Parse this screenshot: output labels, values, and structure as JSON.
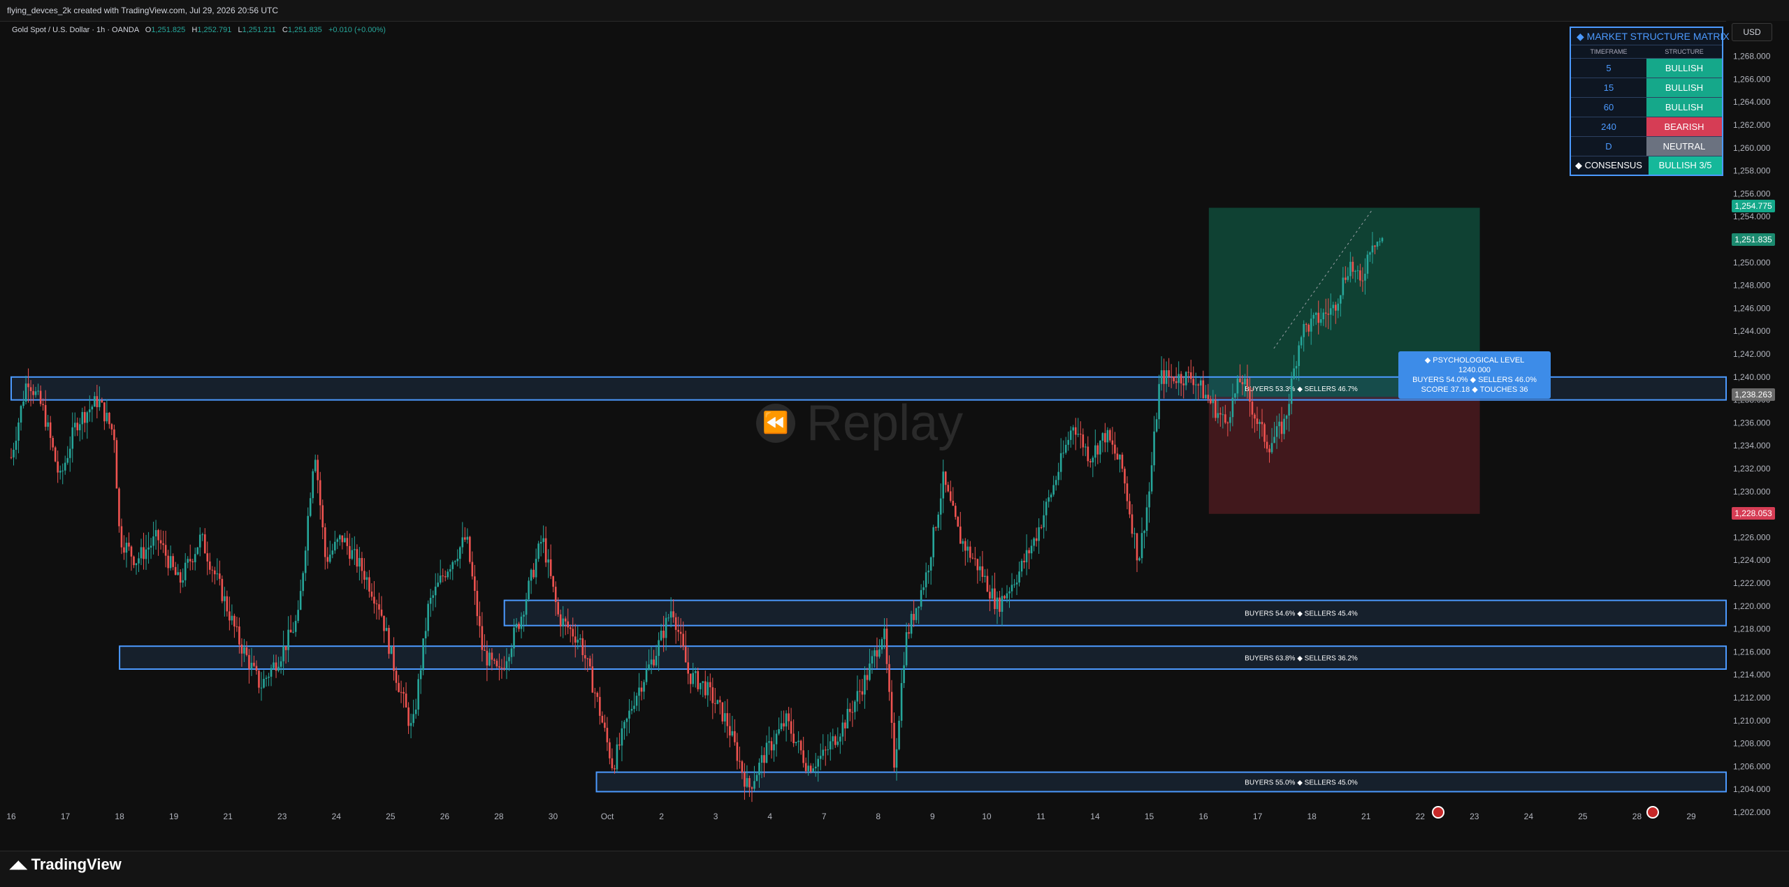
{
  "header": {
    "credit": "flying_devces_2k created with TradingView.com, Jul 29, 2026 20:56 UTC"
  },
  "legend": {
    "symbol": "Gold Spot / U.S. Dollar · 1h · OANDA",
    "o_label": "O",
    "o": "1,251.825",
    "h_label": "H",
    "h": "1,252.791",
    "l_label": "L",
    "l": "1,251.211",
    "c_label": "C",
    "c": "1,251.835",
    "change": "+0.010 (+0.00%)"
  },
  "currency": "USD",
  "watermark": "Replay",
  "footer": {
    "brand": "TradingView"
  },
  "matrix": {
    "title": "MARKET STRUCTURE MATRIX",
    "col_timeframe": "TIMEFRAME",
    "col_structure": "STRUCTURE",
    "rows": [
      {
        "tf": "5",
        "structure": "BULLISH",
        "color": "#15a88a"
      },
      {
        "tf": "15",
        "structure": "BULLISH",
        "color": "#15a88a"
      },
      {
        "tf": "60",
        "structure": "BULLISH",
        "color": "#15a88a"
      },
      {
        "tf": "240",
        "structure": "BEARISH",
        "color": "#d63d55"
      },
      {
        "tf": "D",
        "structure": "NEUTRAL",
        "color": "#6b7280"
      }
    ],
    "consensus_label": "CONSENSUS",
    "consensus_value": "BULLISH  3/5"
  },
  "psych_label": {
    "title": "PSYCHOLOGICAL LEVEL",
    "level": "1240.000",
    "line2": "BUYERS  54.0%   ◆   SELLERS  46.0%",
    "line3": "SCORE  37.18   ◆   TOUCHES  36"
  },
  "price_labels": {
    "target": "1,254.775",
    "current": "1,251.835",
    "entry": "1,238.263",
    "stop": "1,228.053"
  },
  "colors": {
    "up": "#26a69a",
    "down": "#ef5350",
    "zone": "#4c9aff",
    "profit": "#0f4a3a",
    "loss": "#4a1a1f"
  },
  "chart_data": {
    "type": "candlestick",
    "title": "Gold Spot / U.S. Dollar · 1h · OANDA",
    "ylim": [
      1200,
      1270
    ],
    "y_ticks": [
      1202,
      1204,
      1206,
      1208,
      1210,
      1212,
      1214,
      1216,
      1218,
      1220,
      1222,
      1224,
      1226,
      1228,
      1230,
      1232,
      1234,
      1236,
      1238,
      1240,
      1242,
      1244,
      1246,
      1248,
      1250,
      1252,
      1254,
      1256,
      1258,
      1260,
      1262,
      1264,
      1266,
      1268
    ],
    "x_ticks": [
      {
        "label": "16",
        "day": 0
      },
      {
        "label": "17",
        "day": 1
      },
      {
        "label": "18",
        "day": 2
      },
      {
        "label": "19",
        "day": 3
      },
      {
        "label": "21",
        "day": 4
      },
      {
        "label": "23",
        "day": 5
      },
      {
        "label": "24",
        "day": 6
      },
      {
        "label": "25",
        "day": 7
      },
      {
        "label": "26",
        "day": 8
      },
      {
        "label": "28",
        "day": 9
      },
      {
        "label": "30",
        "day": 10
      },
      {
        "label": "Oct",
        "day": 11
      },
      {
        "label": "2",
        "day": 12
      },
      {
        "label": "3",
        "day": 13
      },
      {
        "label": "4",
        "day": 14
      },
      {
        "label": "7",
        "day": 15
      },
      {
        "label": "8",
        "day": 16
      },
      {
        "label": "9",
        "day": 17
      },
      {
        "label": "10",
        "day": 18
      },
      {
        "label": "11",
        "day": 19
      },
      {
        "label": "14",
        "day": 20
      },
      {
        "label": "15",
        "day": 21
      },
      {
        "label": "16",
        "day": 22
      },
      {
        "label": "17",
        "day": 23
      },
      {
        "label": "18",
        "day": 24
      },
      {
        "label": "21",
        "day": 25
      },
      {
        "label": "22",
        "day": 26
      },
      {
        "label": "23",
        "day": 27
      },
      {
        "label": "24",
        "day": 28
      },
      {
        "label": "25",
        "day": 29
      },
      {
        "label": "28",
        "day": 30
      },
      {
        "label": "29",
        "day": 31
      }
    ],
    "x_range_days": [
      0,
      31
    ],
    "path": [
      [
        0.0,
        1233
      ],
      [
        0.3,
        1240
      ],
      [
        0.6,
        1237
      ],
      [
        0.9,
        1231
      ],
      [
        1.2,
        1236
      ],
      [
        1.6,
        1238
      ],
      [
        1.9,
        1235
      ],
      [
        2.0,
        1226
      ],
      [
        2.3,
        1224
      ],
      [
        2.7,
        1226
      ],
      [
        3.1,
        1222
      ],
      [
        3.5,
        1226
      ],
      [
        3.9,
        1221
      ],
      [
        4.2,
        1217
      ],
      [
        4.6,
        1213
      ],
      [
        5.0,
        1216
      ],
      [
        5.3,
        1219
      ],
      [
        5.6,
        1234
      ],
      [
        5.8,
        1224
      ],
      [
        6.1,
        1226
      ],
      [
        6.5,
        1223
      ],
      [
        6.8,
        1220
      ],
      [
        7.1,
        1214
      ],
      [
        7.4,
        1209
      ],
      [
        7.7,
        1220
      ],
      [
        8.0,
        1223
      ],
      [
        8.4,
        1226
      ],
      [
        8.7,
        1216
      ],
      [
        9.0,
        1214
      ],
      [
        9.4,
        1219
      ],
      [
        9.8,
        1226
      ],
      [
        10.1,
        1219
      ],
      [
        10.5,
        1217
      ],
      [
        10.8,
        1212
      ],
      [
        11.1,
        1206
      ],
      [
        11.5,
        1212
      ],
      [
        11.9,
        1216
      ],
      [
        12.2,
        1220
      ],
      [
        12.5,
        1214
      ],
      [
        12.8,
        1213
      ],
      [
        13.2,
        1210
      ],
      [
        13.6,
        1204
      ],
      [
        13.9,
        1207
      ],
      [
        14.3,
        1210
      ],
      [
        14.7,
        1206
      ],
      [
        15.0,
        1207
      ],
      [
        15.4,
        1210
      ],
      [
        15.8,
        1214
      ],
      [
        16.1,
        1218
      ],
      [
        16.3,
        1206
      ],
      [
        16.5,
        1217
      ],
      [
        16.9,
        1223
      ],
      [
        17.2,
        1231
      ],
      [
        17.5,
        1226
      ],
      [
        17.9,
        1223
      ],
      [
        18.2,
        1220
      ],
      [
        18.6,
        1223
      ],
      [
        18.9,
        1226
      ],
      [
        19.2,
        1230
      ],
      [
        19.6,
        1236
      ],
      [
        19.9,
        1233
      ],
      [
        20.2,
        1235
      ],
      [
        20.5,
        1232
      ],
      [
        20.8,
        1224
      ],
      [
        21.0,
        1230
      ],
      [
        21.2,
        1240
      ],
      [
        21.5,
        1240
      ],
      [
        21.8,
        1240
      ],
      [
        22.1,
        1238
      ],
      [
        22.4,
        1236
      ],
      [
        22.7,
        1240
      ],
      [
        23.0,
        1236
      ],
      [
        23.2,
        1234
      ],
      [
        23.5,
        1236
      ],
      [
        23.8,
        1244
      ],
      [
        24.1,
        1245
      ],
      [
        24.4,
        1246
      ],
      [
        24.7,
        1250
      ],
      [
        24.9,
        1248
      ],
      [
        25.1,
        1252
      ],
      [
        25.3,
        1251.8
      ]
    ],
    "zones": [
      {
        "top": 1240,
        "bottom": 1238,
        "start_day": 0,
        "label": "BUYERS  53.3%   ◆   SELLERS  46.7%"
      },
      {
        "top": 1220.5,
        "bottom": 1218.3,
        "start_day": 9.1,
        "label": "BUYERS  54.6%   ◆   SELLERS  45.4%"
      },
      {
        "top": 1216.5,
        "bottom": 1214.5,
        "start_day": 2.0,
        "label": "BUYERS  63.8%   ◆   SELLERS  36.2%"
      },
      {
        "top": 1205.5,
        "bottom": 1203.8,
        "start_day": 10.8,
        "label": "BUYERS  55.0%   ◆   SELLERS  45.0%"
      }
    ],
    "position": {
      "start_day": 22.1,
      "end_day": 27.1,
      "target": 1254.775,
      "entry": 1238.263,
      "stop": 1228.053
    }
  }
}
